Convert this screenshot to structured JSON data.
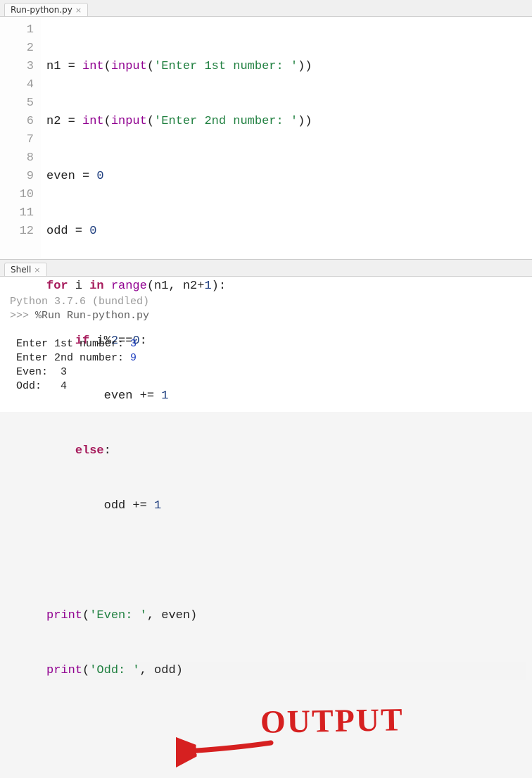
{
  "editor_tab": {
    "label": "Run-python.py",
    "close": "×"
  },
  "shell_tab": {
    "label": "Shell",
    "close": "×"
  },
  "gutter": [
    "1",
    "2",
    "3",
    "4",
    "5",
    "6",
    "7",
    "8",
    "9",
    "10",
    "11",
    "12"
  ],
  "code": {
    "l1": {
      "a": "n1 = ",
      "b": "int",
      "c": "(",
      "d": "input",
      "e": "(",
      "f": "'Enter 1st number: '",
      "g": "))"
    },
    "l2": {
      "a": "n2 = ",
      "b": "int",
      "c": "(",
      "d": "input",
      "e": "(",
      "f": "'Enter 2nd number: '",
      "g": "))"
    },
    "l3": {
      "a": "even = ",
      "b": "0"
    },
    "l4": {
      "a": "odd = ",
      "b": "0"
    },
    "l5": {
      "a": "for",
      "b": " i ",
      "c": "in",
      "d": " ",
      "e": "range",
      "f": "(n1, n2+",
      "g": "1",
      "h": "):"
    },
    "l6": {
      "a": "    ",
      "b": "if",
      "c": " i%",
      "d": "2",
      "e": "==",
      "f": "0",
      "g": ":"
    },
    "l7": {
      "a": "        even += ",
      "b": "1"
    },
    "l8": {
      "a": "    ",
      "b": "else",
      "c": ":"
    },
    "l9": {
      "a": "        odd += ",
      "b": "1"
    },
    "l10": "",
    "l11": {
      "a": "print",
      "b": "(",
      "c": "'Even: '",
      "d": ", even)"
    },
    "l12": {
      "a": "print",
      "b": "(",
      "c": "'Odd: '",
      "d": ", odd)"
    }
  },
  "shell": {
    "version": "Python 3.7.6 (bundled)",
    "prompt": ">>> ",
    "run_cmd": "%Run Run-python.py",
    "out1_label": " Enter 1st number: ",
    "out1_val": "3",
    "out2_label": " Enter 2nd number: ",
    "out2_val": "9",
    "out3": " Even:  3",
    "out4": " Odd:   4"
  },
  "annotation": {
    "text": "OUTPUT"
  }
}
